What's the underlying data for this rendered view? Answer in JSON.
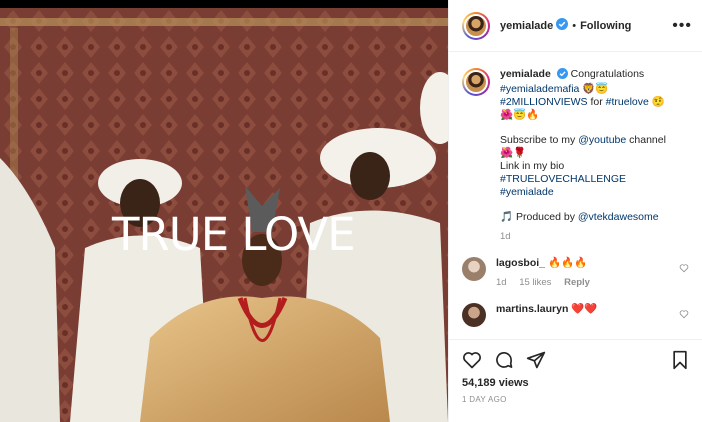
{
  "post": {
    "username": "yemialade",
    "following_label": "Following",
    "more_label": "•••",
    "separator": "•"
  },
  "media": {
    "overlay_text": "TRUE LOVE"
  },
  "caption": {
    "username": "yemialade",
    "text_start": "Congratulations",
    "hashtag_mafia": "#yemialademafia",
    "emoji_mafia": "🦁😇",
    "tag_views": "#2MILLIONVIEWS",
    "for_text": "for",
    "tag_truelove": "#truelove",
    "emoji_after_truelove": "🤨",
    "emoji_line2": "🌺😇🔥",
    "subscribe_text": "Subscribe to my",
    "youtube_mention": "@youtube",
    "channel_text": "channel",
    "emoji_line3": "🌺🌹",
    "bio_text": "Link in my bio",
    "tag_challenge": "#TRUELOVECHALLENGE",
    "tag_yemialade": "#yemialade",
    "music_icon": "🎵",
    "produced_by": "Produced by",
    "producer": "@vtekdawesome",
    "time": "1d"
  },
  "comments": [
    {
      "username": "lagosboi_",
      "text": "🔥🔥🔥",
      "time": "1d",
      "likes": "15 likes",
      "reply": "Reply"
    },
    {
      "username": "martins.lauryn",
      "text": "❤️❤️"
    }
  ],
  "stats": {
    "views": "54,189 views",
    "ago": "1 DAY AGO"
  }
}
